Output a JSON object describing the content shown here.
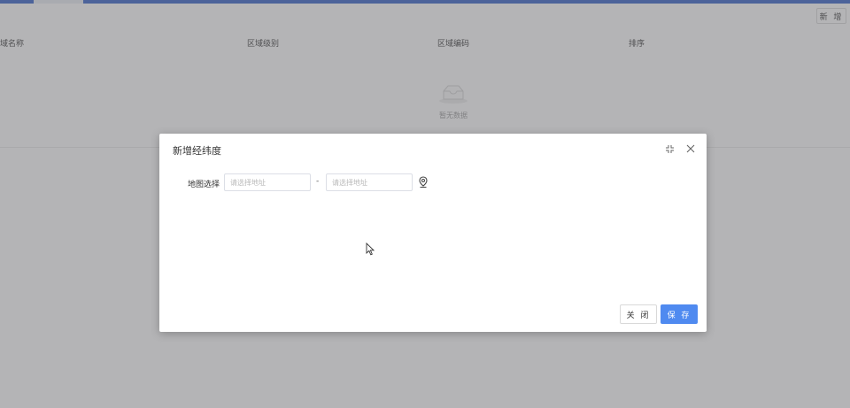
{
  "header": {
    "add_label": "新 增"
  },
  "table": {
    "columns": [
      "域名称",
      "区域级别",
      "区域编码",
      "排序"
    ],
    "empty_text": "暂无数据"
  },
  "modal": {
    "title": "新增经纬度",
    "form": {
      "label": "地图选择",
      "start_placeholder": "请选择地址",
      "end_placeholder": "请选择地址",
      "separator": "-"
    },
    "close_label": "关 闭",
    "save_label": "保 存"
  },
  "colors": {
    "accent": "#4f8af0",
    "topbar": "#2f5dc7"
  },
  "icons": [
    "fullscreen-icon",
    "close-icon",
    "location-pin-icon",
    "empty-inbox-icon",
    "mouse-cursor-icon"
  ]
}
